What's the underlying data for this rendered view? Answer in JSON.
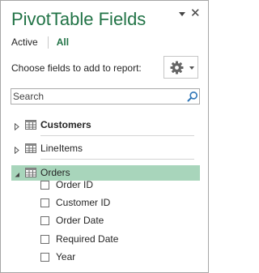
{
  "pane": {
    "title": "PivotTable Fields",
    "options_icon": "chevron-down-icon",
    "close_icon": "close-icon",
    "close_glyph": "✕"
  },
  "tabs": {
    "active_label": "Active",
    "all_label": "All",
    "selected": "All"
  },
  "fields_section": {
    "choose_label": "Choose fields to add to report:",
    "tools_icon": "gear-icon"
  },
  "search": {
    "placeholder": "Search",
    "value": ""
  },
  "tables": [
    {
      "name": "Customers",
      "bold": true,
      "expanded": false,
      "selected": false
    },
    {
      "name": "LineItems",
      "bold": false,
      "expanded": false,
      "selected": false
    },
    {
      "name": "Orders",
      "bold": false,
      "expanded": true,
      "selected": true,
      "fields": [
        {
          "name": "Order ID",
          "checked": false
        },
        {
          "name": "Customer ID",
          "checked": false
        },
        {
          "name": "Order Date",
          "checked": false
        },
        {
          "name": "Required Date",
          "checked": false
        },
        {
          "name": "Year",
          "checked": false
        }
      ]
    }
  ],
  "colors": {
    "accent": "#217346",
    "selection": "#a8d5bb",
    "border": "#a6a6a6"
  }
}
